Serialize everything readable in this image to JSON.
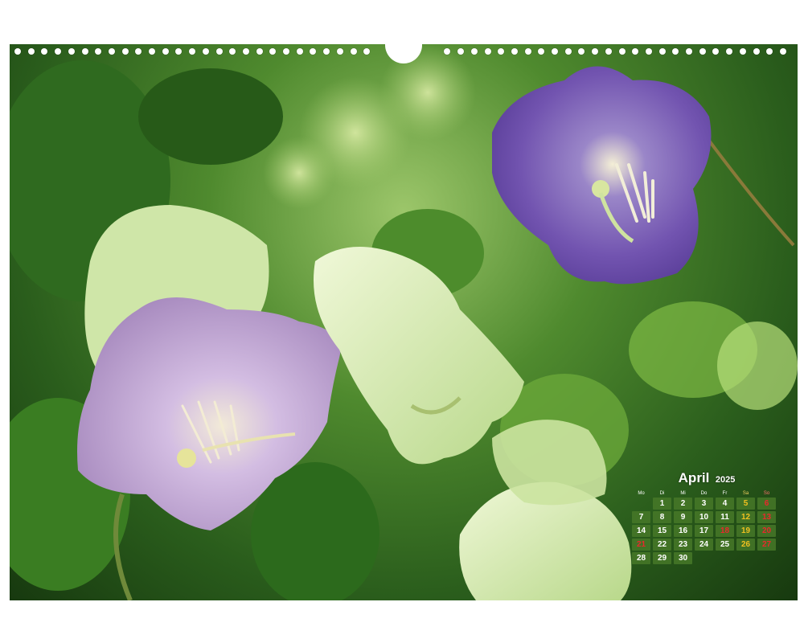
{
  "calendar": {
    "month": "April",
    "year": "2025",
    "weekdays": [
      "Mo",
      "Di",
      "Mi",
      "Do",
      "Fr",
      "Sa",
      "So"
    ],
    "leading_blanks": 1,
    "days": [
      "1",
      "2",
      "3",
      "4",
      "5",
      "6",
      "7",
      "8",
      "9",
      "10",
      "11",
      "12",
      "13",
      "14",
      "15",
      "16",
      "17",
      "18",
      "19",
      "20",
      "21",
      "22",
      "23",
      "24",
      "25",
      "26",
      "27",
      "28",
      "29",
      "30"
    ],
    "holidays": [
      "18",
      "21"
    ],
    "colors": {
      "cell": "#467828",
      "saturday": "#f0c020",
      "sunday": "#e8282c"
    }
  },
  "photo": {
    "subject": "purple-bell-flowers",
    "colors": {
      "dark_flower": "#7a5bb8",
      "pale_flower": "#c9b4d8",
      "green_bell": "#d8ecb0",
      "foliage": "#3f7a26"
    }
  }
}
